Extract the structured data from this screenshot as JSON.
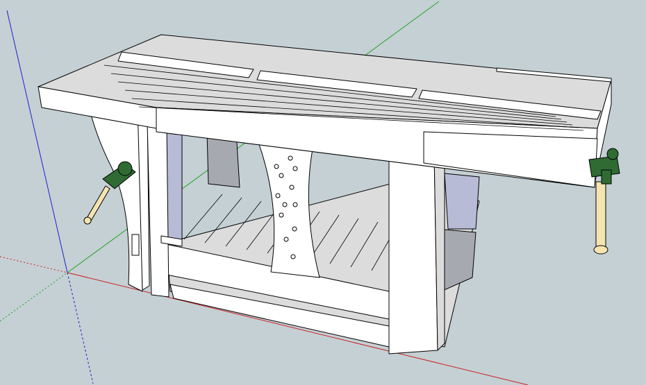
{
  "viewport": {
    "background": "#c4d0d4",
    "axes": {
      "red": "#cc1f1f",
      "green": "#1fa31f",
      "blue": "#1f1fcc"
    }
  },
  "model": {
    "face_light": "#ffffff",
    "face_top": "#dcdcdc",
    "face_shadow": "#a6a9b0",
    "face_blue": "#b8bbd6",
    "edge": "#000000",
    "vise_green": "#2f6b33",
    "vise_handle": "#f4e4b0"
  }
}
